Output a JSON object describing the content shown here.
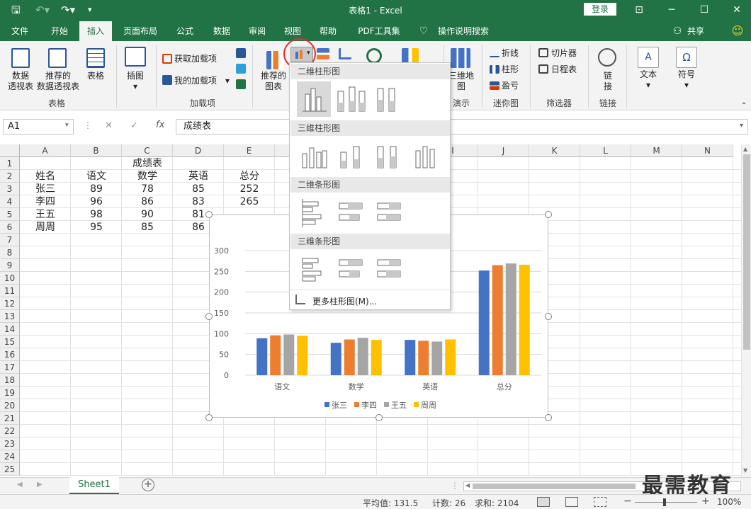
{
  "titlebar": {
    "title": "表格1 - Excel",
    "login": "登录"
  },
  "tabs": [
    "文件",
    "开始",
    "插入",
    "页面布局",
    "公式",
    "数据",
    "审阅",
    "视图",
    "帮助",
    "PDF工具集",
    "操作说明搜索"
  ],
  "share": "共享",
  "ribbon": {
    "pivot": [
      "数据",
      "透视表"
    ],
    "rec_pivot": [
      "推荐的",
      "数据透视表"
    ],
    "table": "表格",
    "group_table": "表格",
    "illustrations": "插图",
    "get_addins": "获取加载项",
    "my_addins": "我的加载项",
    "group_addins": "加载项",
    "rec_charts": [
      "推荐的",
      "图表"
    ],
    "map3d": [
      "三维地",
      "图"
    ],
    "group_demo": "演示",
    "line": "折线",
    "column": "柱形",
    "winloss": "盈亏",
    "group_spark": "迷你图",
    "slicer": "切片器",
    "timeline": "日程表",
    "group_filter": "筛选器",
    "link": [
      "链",
      "接"
    ],
    "group_link": "链接",
    "text": "文本",
    "symbol": "符号"
  },
  "formula": {
    "namebox": "A1",
    "content": "成绩表"
  },
  "columns": [
    "A",
    "B",
    "C",
    "D",
    "E",
    "F",
    "G",
    "H",
    "I",
    "J",
    "K",
    "L",
    "M",
    "N"
  ],
  "rows": [
    "1",
    "2",
    "3",
    "4",
    "5",
    "6",
    "7",
    "8",
    "9",
    "10",
    "11",
    "12",
    "13",
    "14",
    "15",
    "16",
    "17",
    "18",
    "19",
    "20",
    "21",
    "22",
    "23",
    "24",
    "25"
  ],
  "sheet_title": "成绩表",
  "headers": [
    "姓名",
    "语文",
    "数学",
    "英语",
    "总分"
  ],
  "data": [
    [
      "张三",
      "89",
      "78",
      "85",
      "252"
    ],
    [
      "李四",
      "96",
      "86",
      "83",
      "265"
    ],
    [
      "王五",
      "98",
      "90",
      "81"
    ],
    [
      "周周",
      "95",
      "85",
      "86"
    ]
  ],
  "dropdown": {
    "sec1": "二维柱形图",
    "sec2": "三维柱形图",
    "sec3": "二维条形图",
    "sec4": "三维条形图",
    "more": "更多柱形图(M)..."
  },
  "chart_data": {
    "type": "bar",
    "categories": [
      "语文",
      "数学",
      "英语",
      "总分"
    ],
    "series": [
      {
        "name": "张三",
        "color": "#4472c4",
        "values": [
          89,
          78,
          85,
          252
        ]
      },
      {
        "name": "李四",
        "color": "#ed7d31",
        "values": [
          96,
          86,
          83,
          265
        ]
      },
      {
        "name": "王五",
        "color": "#a5a5a5",
        "values": [
          98,
          90,
          81,
          269
        ]
      },
      {
        "name": "周周",
        "color": "#ffc000",
        "values": [
          95,
          85,
          86,
          266
        ]
      }
    ],
    "yticks": [
      "0",
      "50",
      "100",
      "150",
      "200",
      "250",
      "300"
    ],
    "ylim": [
      0,
      300
    ],
    "legend": "bottom",
    "grid": true
  },
  "sheettab": "Sheet1",
  "status": {
    "avg": "平均值: 131.5",
    "count": "计数: 26",
    "sum": "求和: 2104",
    "zoom": "100%"
  },
  "watermark": "最需教育"
}
